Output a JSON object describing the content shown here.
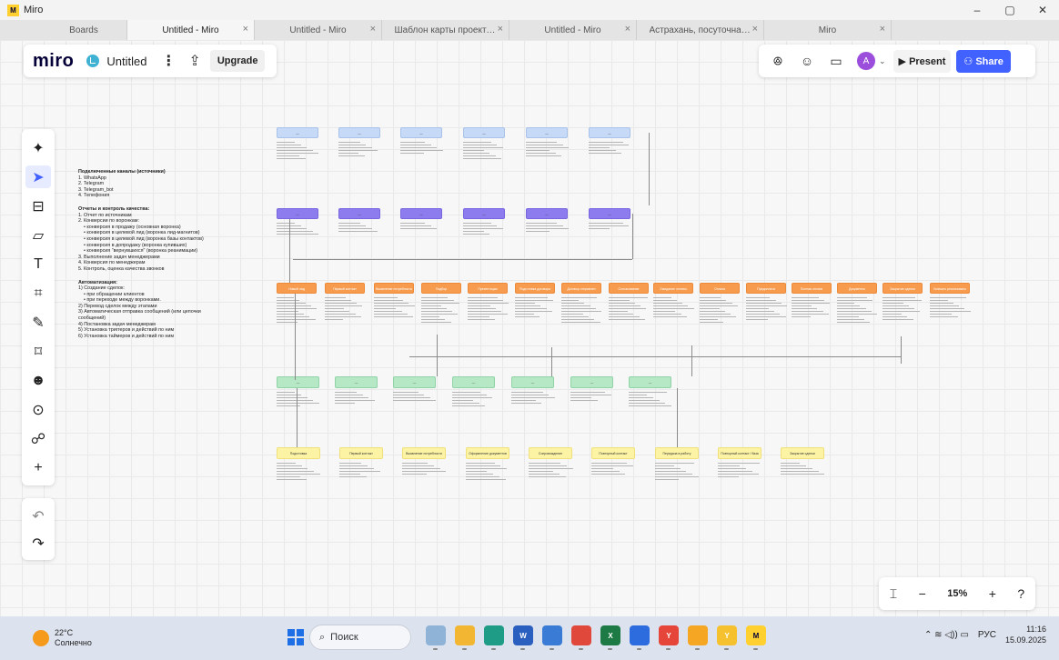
{
  "window": {
    "title": "Miro",
    "minimize": "–",
    "maximize": "▢",
    "close": "✕"
  },
  "tabs": [
    {
      "label": "Boards",
      "closable": false
    },
    {
      "label": "Untitled - Miro",
      "closable": true,
      "active": true
    },
    {
      "label": "Untitled - Miro",
      "closable": true
    },
    {
      "label": "Шаблон карты проекта, ...",
      "closable": true
    },
    {
      "label": "Untitled - Miro",
      "closable": true
    },
    {
      "label": "Астрахань, посуточная а...",
      "closable": true
    },
    {
      "label": "Miro",
      "closable": true
    }
  ],
  "toolbar": {
    "brand": "miro",
    "board_name": "Untitled",
    "menu": "⋮",
    "export": "⇪",
    "upgrade": "Upgrade"
  },
  "top_right": {
    "reactions": "ꔮ",
    "comment": "☺",
    "video": "▭",
    "avatar_initial": "A",
    "caret": "⌄",
    "present": "▶ Present",
    "share": "⚇ Share"
  },
  "left_tools": [
    {
      "icon": "✦",
      "name": "ai-sparkle-icon"
    },
    {
      "icon": "➤",
      "name": "select-cursor-icon",
      "active": true
    },
    {
      "icon": "⊟",
      "name": "templates-icon"
    },
    {
      "icon": "▱",
      "name": "sticky-note-icon"
    },
    {
      "icon": "T",
      "name": "text-tool-icon"
    },
    {
      "icon": "⌗",
      "name": "shapes-icon"
    },
    {
      "icon": "✎",
      "name": "pen-icon"
    },
    {
      "icon": "⌑",
      "name": "frame-icon"
    },
    {
      "icon": "☻",
      "name": "sticker-icon"
    },
    {
      "icon": "⊙",
      "name": "comment-tool-icon"
    },
    {
      "icon": "☍",
      "name": "connector-icon"
    },
    {
      "icon": "+",
      "name": "more-tools-icon"
    }
  ],
  "history": {
    "undo": "↶",
    "redo": "↷"
  },
  "notes": [
    {
      "title": "Подключенные каналы (источники)",
      "lines": [
        {
          "text": "1. WhatsApp"
        },
        {
          "text": "2. Telegram"
        },
        {
          "text": "3. Telegram_bot"
        },
        {
          "text": "4. Телефония"
        }
      ]
    },
    {
      "title": "Отчеты и контроль качества:",
      "lines": [
        {
          "text": "1. Отчет по источникам"
        },
        {
          "text": "2. Конверсии по воронкам:"
        },
        {
          "text": "• конверсия в продажу (основная воронка)",
          "sub": true
        },
        {
          "text": "• конверсия в целевой лид (воронка лид-магнитов)",
          "sub": true
        },
        {
          "text": "• конверсия в целевой лид (воронка базы контактов)",
          "sub": true
        },
        {
          "text": "• конверсия в допродажу (воронка купивших)",
          "sub": true
        },
        {
          "text": "• конверсия \"вернувшихся\" (воронка реанимации)",
          "sub": true
        },
        {
          "text": "3. Выполнение задач менеджерами"
        },
        {
          "text": "4. Конверсия по менеджерам"
        },
        {
          "text": "5. Контроль, оценка качества звонков"
        }
      ]
    },
    {
      "title": "Автоматизация:",
      "lines": [
        {
          "text": "1) Создание сделок:"
        },
        {
          "text": "• при обращении клиентов",
          "sub": true
        },
        {
          "text": "• при переходе между воронками.",
          "sub": true
        },
        {
          "text": "2) Перевод сделок между этапами"
        },
        {
          "text": "3) Автоматическая отправка сообщений (или цепочки сообщений)"
        },
        {
          "text": "4) Постановка задач менеджерам"
        },
        {
          "text": "5) Установка триггеров и действий по ним"
        },
        {
          "text": "6) Установка таймеров и действий по ним"
        }
      ]
    }
  ],
  "rows": {
    "blue": {
      "labels": [
        "—",
        "—",
        "—",
        "—",
        "—",
        "—"
      ]
    },
    "purple": {
      "labels": [
        "—",
        "—",
        "—",
        "—",
        "—",
        "—"
      ]
    },
    "orange": {
      "labels": [
        "Новый лид",
        "Первый контакт",
        "Выявление потребности",
        "Подбор",
        "Презентация",
        "Подготовка договора",
        "Договор отправлен",
        "Согласование",
        "Ожидание оплаты",
        "Оплата",
        "Предоплата",
        "Полная оплата",
        "Документы",
        "Закрытие сделки",
        "Успешно реализовано"
      ]
    },
    "green": {
      "labels": [
        "—",
        "—",
        "—",
        "—",
        "—",
        "—",
        "—"
      ]
    },
    "yellow": {
      "labels": [
        "Подготовка",
        "Первый контакт",
        "Выявление потребности",
        "Оформление документов",
        "Сопровождение",
        "Повторный контакт",
        "Передача в работу",
        "Повторный контакт / база",
        "Закрытие сделки"
      ]
    }
  },
  "zoom": {
    "fit": "⌶",
    "out": "−",
    "value": "15%",
    "in": "+",
    "help": "?"
  },
  "taskbar": {
    "temperature": "22°C",
    "weather": "Солнечно",
    "search": "Поиск",
    "lang": "РУС",
    "tray_icons": "⌃  ≋ ◁)) ▭",
    "time": "11:16",
    "date": "15.09.2025"
  },
  "colors": {
    "miro_yellow": "#ffd02f",
    "share_blue": "#4262ff",
    "card_blue": "#c6d9f6",
    "card_purple": "#8c7cee",
    "card_orange": "#f79b4f",
    "card_green": "#b7e8c6",
    "card_yellow": "#fcf3a4"
  }
}
